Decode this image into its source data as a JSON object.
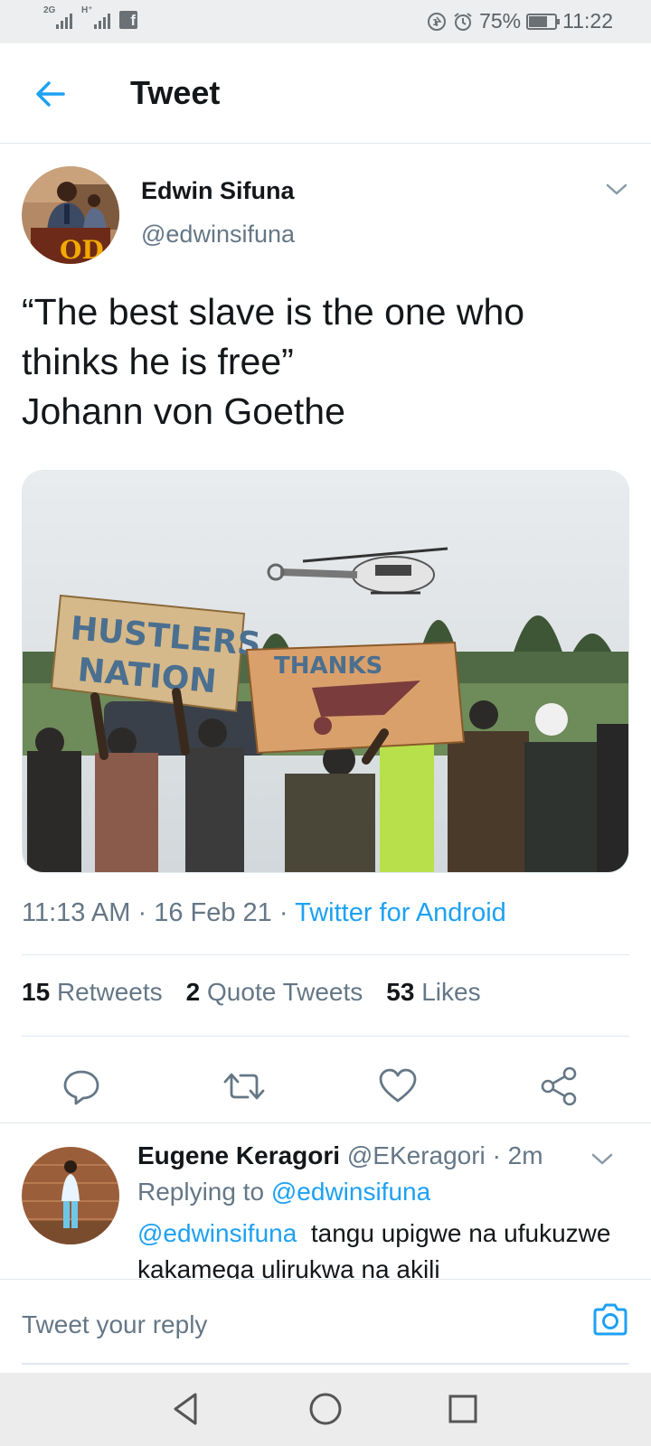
{
  "status_bar": {
    "network1": "2G",
    "network2": "H⁺",
    "app_icon": "facebook-icon",
    "battery": "75%",
    "battery_level": 0.75,
    "time": "11:22"
  },
  "header": {
    "back_icon": "arrow-left-icon",
    "title": "Tweet"
  },
  "tweet": {
    "author_name": "Edwin Sifuna",
    "author_handle": "@edwinsifuna",
    "text": "“The best slave is the one who thinks he is free”\nJohann von Goethe",
    "image_signs": {
      "sign1": "HUSTLERS NATION",
      "sign2": "THANKS"
    },
    "time": "11:13 AM",
    "date": "16 Feb 21",
    "source": "Twitter for Android",
    "sep": "·",
    "stats": {
      "retweets_count": "15",
      "retweets_label": "Retweets",
      "quotes_count": "2",
      "quotes_label": "Quote Tweets",
      "likes_count": "53",
      "likes_label": "Likes"
    }
  },
  "reply": {
    "name": "Eugene Keragori",
    "handle": "@EKeragori",
    "sep": "·",
    "time": "2m",
    "replying_prefix": "Replying to",
    "replying_handle": "@edwinsifuna",
    "mention": "@edwinsifuna",
    "text": "tangu upigwe na ufukuzwe kakamega ulirukwa na akili"
  },
  "composer": {
    "placeholder": "Tweet your reply"
  },
  "colors": {
    "accent": "#1da1f2",
    "text": "#14171a",
    "muted": "#657786",
    "divider": "#e1e8ed"
  }
}
